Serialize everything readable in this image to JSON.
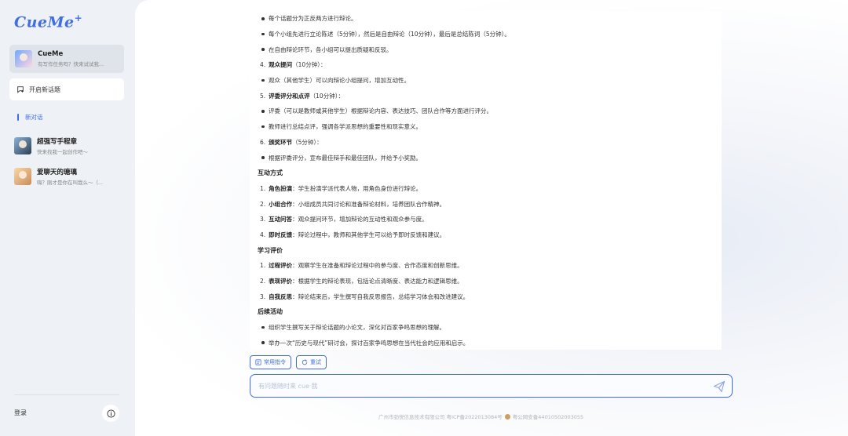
{
  "sidebar": {
    "logo": "CueMe",
    "logo_plus": "+",
    "bot": {
      "name": "CueMe",
      "subtitle": "有写作任务吗？快来试试我..."
    },
    "new_topic": "开启新话题",
    "conversation_label": "新对话",
    "chats": [
      {
        "name": "超强写手程章",
        "subtitle": "快来找我一起创作吧～"
      },
      {
        "name": "爱聊天的瑭璃",
        "subtitle": "嗨？刚才是你在叫我么～（..."
      }
    ],
    "login": "登录"
  },
  "content": {
    "lines": [
      {
        "type": "bullet",
        "text": "每个话题分为正反两方进行辩论。"
      },
      {
        "type": "bullet",
        "text": "每个小组先进行立论陈述（5分钟），然后是自由辩论（10分钟），最后是总结陈词（5分钟）。"
      },
      {
        "type": "bullet",
        "text": "在自由辩论环节，各小组可以提出质疑和反驳。"
      },
      {
        "type": "num",
        "n": "4.",
        "bold": "观众提问",
        "text": "（10分钟）："
      },
      {
        "type": "bullet",
        "text": "观众（其他学生）可以向辩论小组提问，增加互动性。"
      },
      {
        "type": "num",
        "n": "5.",
        "bold": "评委评分和点评",
        "text": "（10分钟）："
      },
      {
        "type": "bullet",
        "text": "评委（可以是教师或其他学生）根据辩论内容、表达技巧、团队合作等方面进行评分。"
      },
      {
        "type": "bullet",
        "text": "教师进行总结点评，强调各学派思想的重要性和现实意义。"
      },
      {
        "type": "num",
        "n": "6.",
        "bold": "颁奖环节",
        "text": "（5分钟）："
      },
      {
        "type": "bullet",
        "text": "根据评委评分，宣布最佳辩手和最佳团队，并给予小奖励。"
      },
      {
        "type": "head",
        "text": "互动方式"
      },
      {
        "type": "num",
        "n": "1.",
        "bold": "角色扮演",
        "text": "：学生扮演学派代表人物，用角色身份进行辩论。"
      },
      {
        "type": "num",
        "n": "2.",
        "bold": "小组合作",
        "text": "：小组成员共同讨论和准备辩论材料，培养团队合作精神。"
      },
      {
        "type": "num",
        "n": "3.",
        "bold": "互动问答",
        "text": "：观众提问环节，增加辩论的互动性和观众参与度。"
      },
      {
        "type": "num",
        "n": "4.",
        "bold": "即时反馈",
        "text": "：辩论过程中，教师和其他学生可以给予即时反馈和建议。"
      },
      {
        "type": "head",
        "text": "学习评价"
      },
      {
        "type": "num",
        "n": "1.",
        "bold": "过程评价",
        "text": "：观察学生在准备和辩论过程中的参与度、合作态度和创新思维。"
      },
      {
        "type": "num",
        "n": "2.",
        "bold": "表现评价",
        "text": "：根据学生的辩论表现，包括论点清晰度、表达能力和逻辑思维。"
      },
      {
        "type": "num",
        "n": "3.",
        "bold": "自我反思",
        "text": "：辩论结束后，学生撰写自我反思报告，总结学习体会和改进建议。"
      },
      {
        "type": "head",
        "text": "后续活动"
      },
      {
        "type": "bullet",
        "text": "组织学生撰写关于辩论话题的小论文，深化对百家争鸣思想的理解。"
      },
      {
        "type": "bullet",
        "text": "举办一次“历史与现代”研讨会，探讨百家争鸣思想在当代社会的应用和启示。"
      }
    ]
  },
  "actions": {
    "common_commands": "常用指令",
    "retry": "重试"
  },
  "input": {
    "placeholder": "有问题随时来 cue 我"
  },
  "footer": {
    "company": "广州市劲悦信息技术有限公司 粤ICP备2022013084号",
    "police": "粤公网安备44010502003055"
  },
  "colors": {
    "accent": "#3f6ee8",
    "sidebar_bg": "#eef1f5",
    "bot_card_bg": "#dfe4ea"
  }
}
